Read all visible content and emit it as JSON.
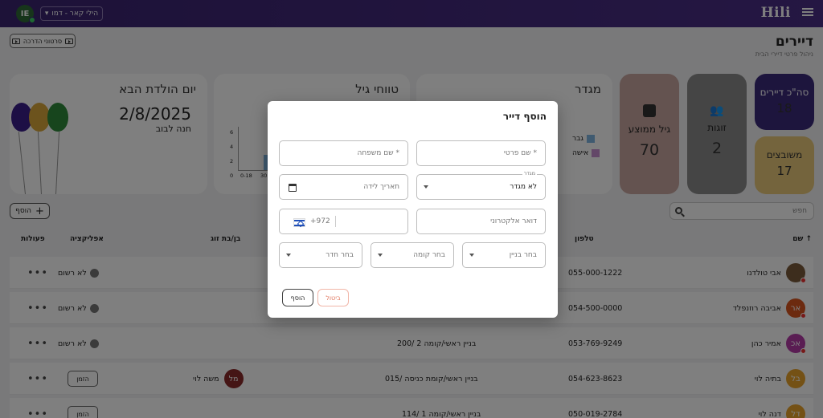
{
  "topbar": {
    "logo": "Hili",
    "user_initials": "IE",
    "org_select": "הילי קאר - דמו"
  },
  "header": {
    "title": "דיירים",
    "subtitle": "ניהול פרטי דיירי הבית",
    "tutorial_label": "סרטוני הדרכה"
  },
  "stats": [
    {
      "title": "סה\"כ דיירים",
      "value": "18",
      "color": "#3b2a7a",
      "text": "#ffffff"
    },
    {
      "title": "משובצים",
      "value": "17",
      "color": "#e8c97a",
      "text": "#333333"
    },
    {
      "title": "זוגות",
      "value": "2",
      "color": "#8b8b8b",
      "text": "#222222"
    },
    {
      "title": "גיל ממוצע",
      "value": "70",
      "color": "#c8a7a0",
      "text": "#222222"
    }
  ],
  "widgets": {
    "gender_title": "מגדר",
    "gender_legend": [
      "גבר",
      "אישה"
    ],
    "age_title": "טווחי גיל",
    "age_ticks_y": [
      "6",
      "4",
      "2",
      "0"
    ],
    "age_ticks_x": [
      "0-18",
      "30"
    ],
    "birthday_title": "יום הולדת הבא",
    "birthday_date": "2/8/2025",
    "birthday_name": "חנה לבוב"
  },
  "toolbar": {
    "search_placeholder": "חפש",
    "add_label": "הוסף"
  },
  "table": {
    "headers": {
      "name": "שם",
      "phone": "טלפון",
      "partner": "בן/בת זוג",
      "app": "אפליקציה",
      "actions": "פעולות"
    },
    "rows": [
      {
        "initials": "",
        "name": "אבי טולדנו",
        "phone": "055-000-1222",
        "room": "",
        "partner": "",
        "partner_initials": "",
        "app": "לא רשום",
        "avatar_color": "#7a5a3a"
      },
      {
        "initials": "אר",
        "name": "אביבה רוזנפלד",
        "phone": "054-500-0000",
        "room": "",
        "partner": "",
        "partner_initials": "",
        "app": "לא רשום",
        "avatar_color": "#d9541e"
      },
      {
        "initials": "אכ",
        "name": "אמיר כהן",
        "phone": "053-769-9249",
        "room": "בניין ראשי/קומה 2 /200",
        "partner": "",
        "partner_initials": "",
        "app": "לא רשום",
        "avatar_color": "#b53aa6"
      },
      {
        "initials": "בל",
        "name": "בתיה לוי",
        "phone": "054-623-8623",
        "room": "בניין ראשי/קומת כניסה /015",
        "partner": "משה לוי",
        "partner_initials": "מל",
        "app": "הזמן",
        "avatar_color": "#e8a22a"
      },
      {
        "initials": "דל",
        "name": "דנה לוי",
        "phone": "050-019-2784",
        "room": "בניין ראשי/קומה 1 /114",
        "partner": "",
        "partner_initials": "",
        "app": "הזמן",
        "avatar_color": "#e8a22a"
      }
    ]
  },
  "modal": {
    "title": "הוסף דייר",
    "first_name": "שם פרטי *",
    "last_name": "שם משפחה *",
    "gender_legend": "מגדר",
    "gender_value": "לא מגדר",
    "birthdate": "תאריך לידה",
    "email": "דואר אלקטרוני",
    "phone_prefix": "+972",
    "building": "בחר בניין",
    "floor": "בחר קומה",
    "room": "בחר חדר",
    "cancel": "ביטול",
    "submit": "הוסף"
  }
}
